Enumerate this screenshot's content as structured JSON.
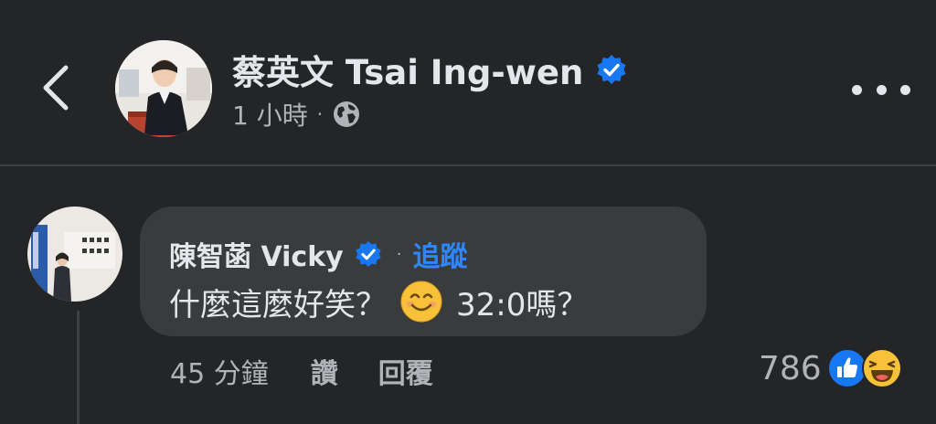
{
  "header": {
    "page_name": "蔡英文 Tsai Ing-wen",
    "timestamp": "1 小時",
    "dot": "·",
    "privacy_icon": "globe-icon",
    "back_icon": "chevron-left-icon",
    "more_icon": "more-dots-icon"
  },
  "comment": {
    "author": "陳智菡 Vicky",
    "follow_separator": "·",
    "follow_label": "追蹤",
    "text_before_emoji": "什麼這麼好笑？",
    "emoji": "smiling-face-emoji",
    "text_after_emoji": "32:0嗎？",
    "time": "45 分鐘",
    "like_label": "讚",
    "reply_label": "回覆",
    "reaction_count": "786",
    "reactions": [
      "like",
      "haha"
    ]
  },
  "colors": {
    "background": "#242526",
    "bubble": "#3a3b3c",
    "primary_text": "#e4e6eb",
    "secondary_text": "#b0b3b8",
    "link_blue": "#2d88ff",
    "verified_blue": "#1877f2"
  }
}
